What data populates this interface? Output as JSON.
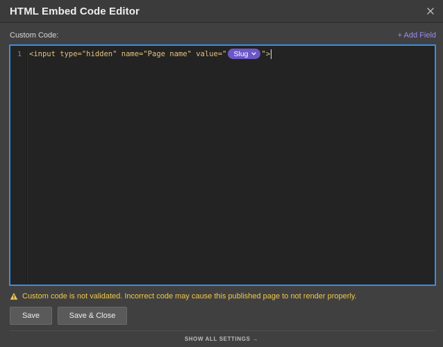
{
  "dialog": {
    "title": "HTML Embed Code Editor"
  },
  "editor": {
    "label": "Custom Code:",
    "add_field": "+ Add Field",
    "line_number": "1",
    "code": {
      "prefix": "<input type=\"hidden\" name=\"Page name\" value=\"",
      "field_chip": "Slug",
      "suffix": "\">"
    }
  },
  "warning": {
    "text": "Custom code is not validated. Incorrect code may cause this published page to not render properly."
  },
  "buttons": {
    "save": "Save",
    "save_close": "Save & Close"
  },
  "footer": {
    "show_all": "SHOW ALL SETTINGS",
    "arrow": "→"
  },
  "colors": {
    "accent_border": "#3a8ee6",
    "chip": "#6b57c7",
    "warning": "#f0c84a",
    "link": "#9f8cf0"
  },
  "icons": [
    "close-icon",
    "chevron-down-icon",
    "warning-icon",
    "arrow-right-icon"
  ]
}
